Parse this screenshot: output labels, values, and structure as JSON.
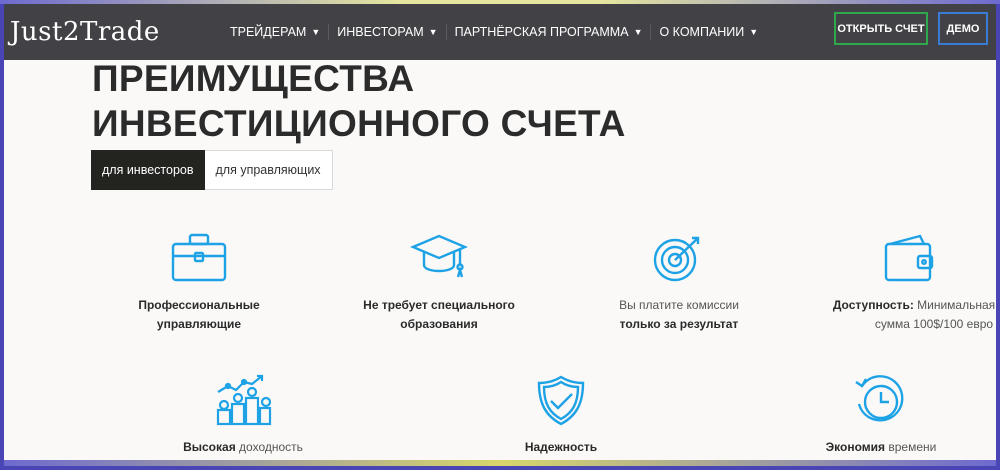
{
  "header": {
    "logo": "Just2Trade",
    "menu": [
      {
        "label": "ТРЕЙДЕРАМ"
      },
      {
        "label": "ИНВЕСТОРАМ"
      },
      {
        "label": "ПАРТНЁРСКАЯ ПРОГРАММА"
      },
      {
        "label": "О КОМПАНИИ"
      }
    ],
    "open_account": "ОТКРЫТЬ СЧЕТ",
    "demo": "ДЕМО"
  },
  "title": {
    "line1": "ПРЕИМУЩЕСТВА",
    "line2": "ИНВЕСТИЦИОННОГО СЧЕТА"
  },
  "tabs": [
    {
      "label": "для инвесторов",
      "active": true
    },
    {
      "label": "для управляющих",
      "active": false
    }
  ],
  "features": [
    {
      "icon": "briefcase-icon",
      "line1": "Профессиональные",
      "line2": "управляющие"
    },
    {
      "icon": "graduation-cap-icon",
      "line1": "Не требует специального",
      "line2": "образования"
    },
    {
      "icon": "target-icon",
      "line1": "Вы платите комиссии",
      "line2": "только за результат"
    },
    {
      "icon": "wallet-icon",
      "bold": "Доступность:",
      "rest": " Минимальная",
      "line2": "сумма 100$/100 евро"
    },
    {
      "icon": "growth-coins-icon",
      "bold": "Высокая",
      "rest": " доходность"
    },
    {
      "icon": "shield-check-icon",
      "bold": "Надежность"
    },
    {
      "icon": "clock-icon",
      "bold": "Экономия",
      "rest": " времени"
    }
  ],
  "colors": {
    "icon": "#1ea2e6",
    "navbar": "#343438",
    "open_border": "#2ea84a",
    "demo_border": "#3a7bd5"
  }
}
